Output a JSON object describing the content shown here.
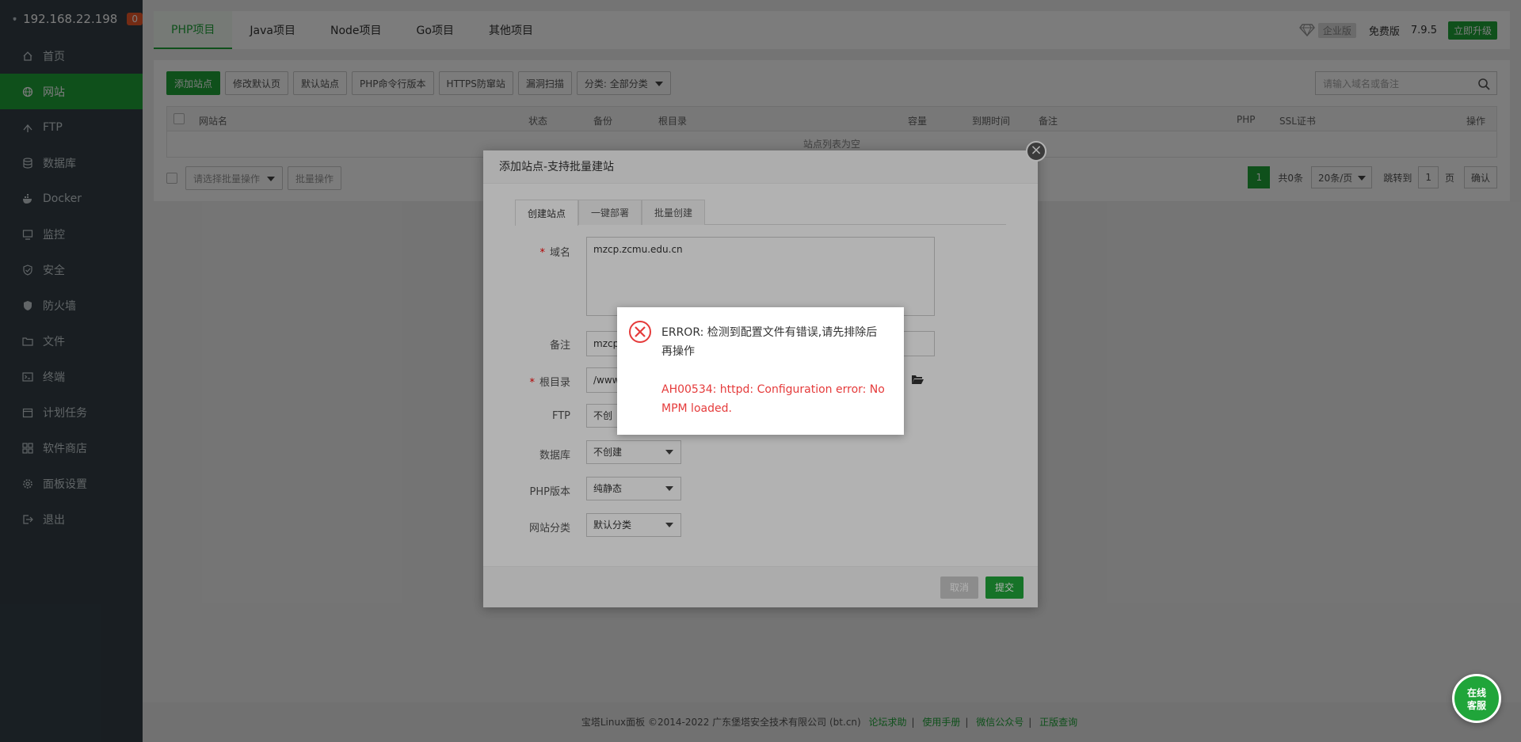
{
  "sidebar": {
    "host": "192.168.22.198",
    "badge": "0",
    "items": [
      {
        "label": "首页",
        "icon": "home-icon"
      },
      {
        "label": "网站",
        "icon": "globe-icon"
      },
      {
        "label": "FTP",
        "icon": "ftp-icon"
      },
      {
        "label": "数据库",
        "icon": "database-icon"
      },
      {
        "label": "Docker",
        "icon": "docker-icon"
      },
      {
        "label": "监控",
        "icon": "monitor-icon"
      },
      {
        "label": "安全",
        "icon": "shield-check-icon"
      },
      {
        "label": "防火墙",
        "icon": "firewall-icon"
      },
      {
        "label": "文件",
        "icon": "folder-icon"
      },
      {
        "label": "终端",
        "icon": "terminal-icon"
      },
      {
        "label": "计划任务",
        "icon": "calendar-icon"
      },
      {
        "label": "软件商店",
        "icon": "apps-icon"
      },
      {
        "label": "面板设置",
        "icon": "gear-icon"
      },
      {
        "label": "退出",
        "icon": "logout-icon"
      }
    ]
  },
  "topbar": {
    "tabs": [
      "PHP项目",
      "Java项目",
      "Node项目",
      "Go项目",
      "其他项目"
    ],
    "enterprise": "企业版",
    "free": "免费版",
    "version": "7.9.5",
    "upgrade": "立即升级"
  },
  "toolbar": {
    "add_site": "添加站点",
    "edit_default": "修改默认页",
    "default_site": "默认站点",
    "php_cli": "PHP命令行版本",
    "https_guard": "HTTPS防窜站",
    "vuln_scan": "漏洞扫描",
    "category": "分类: 全部分类",
    "search_placeholder": "请输入域名或备注"
  },
  "table": {
    "headers": {
      "site_name": "网站名",
      "status": "状态",
      "backup": "备份",
      "root": "根目录",
      "capacity": "容量",
      "expire": "到期时间",
      "note": "备注",
      "php": "PHP",
      "ssl": "SSL证书",
      "action": "操作"
    },
    "empty": "站点列表为空"
  },
  "batch": {
    "placeholder": "请选择批量操作",
    "button": "批量操作"
  },
  "pager": {
    "current": "1",
    "total": "共0条",
    "per_page": "20条/页",
    "jump_to": "跳转到",
    "page_value": "1",
    "page_unit": "页",
    "confirm": "确认"
  },
  "footer": {
    "copyright": "宝塔Linux面板 ©2014-2022 广东堡塔安全技术有限公司 (bt.cn)",
    "links": [
      "论坛求助",
      "使用手册",
      "微信公众号",
      "正版查询"
    ]
  },
  "modal": {
    "title": "添加站点-支持批量建站",
    "tabs": [
      "创建站点",
      "一键部署",
      "批量创建"
    ],
    "domain_label": "域名",
    "domain_value": "mzcp.zcmu.edu.cn",
    "note_label": "备注",
    "note_value": "mzcp",
    "root_label": "根目录",
    "root_value": "/www",
    "ftp_label": "FTP",
    "ftp_value": "不创",
    "db_label": "数据库",
    "db_value": "不创建",
    "php_label": "PHP版本",
    "php_value": "纯静态",
    "category_label": "网站分类",
    "category_value": "默认分类",
    "cancel": "取消",
    "submit": "提交"
  },
  "error": {
    "message": "ERROR: 检测到配置文件有错误,请先排除后再操作",
    "detail": "AH00534: httpd: Configuration error: No MPM loaded."
  },
  "chat": {
    "line1": "在线",
    "line2": "客服"
  },
  "colors": {
    "accent": "#20a53a",
    "sidebar_bg": "#344047",
    "error_red": "#e53b3b"
  }
}
